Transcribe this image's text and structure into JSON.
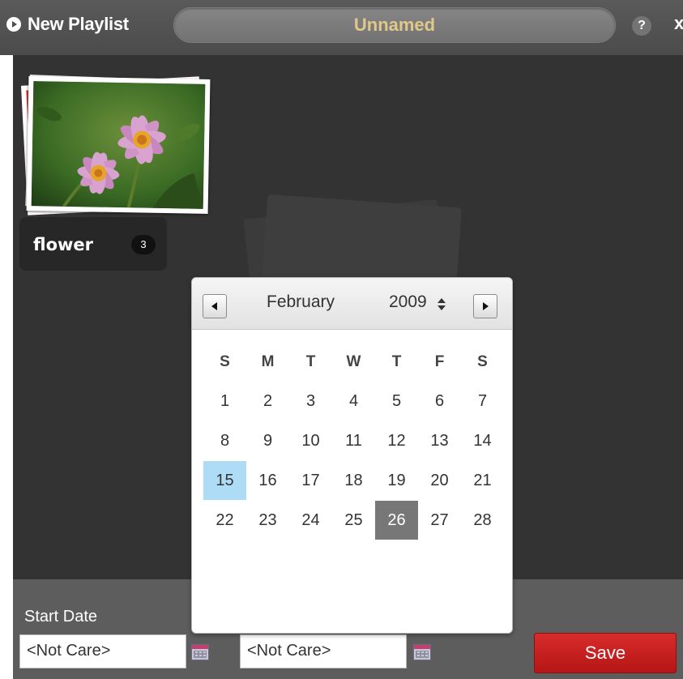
{
  "header": {
    "title": "New Playlist",
    "playlist_name": "Unnamed",
    "help_label": "?",
    "close_label": "x"
  },
  "album": {
    "name": "flower",
    "count": "3"
  },
  "calendar": {
    "month": "February",
    "year": "2009",
    "days_of_week": [
      "S",
      "M",
      "T",
      "W",
      "T",
      "F",
      "S"
    ],
    "weeks": [
      [
        "1",
        "2",
        "3",
        "4",
        "5",
        "6",
        "7"
      ],
      [
        "8",
        "9",
        "10",
        "11",
        "12",
        "13",
        "14"
      ],
      [
        "15",
        "16",
        "17",
        "18",
        "19",
        "20",
        "21"
      ],
      [
        "22",
        "23",
        "24",
        "25",
        "26",
        "27",
        "28"
      ]
    ],
    "highlighted_day": "15",
    "selected_day": "26"
  },
  "bottom_bar": {
    "start_date_label": "Start Date",
    "start_date_value": "<Not Care>",
    "end_date_value": "<Not Care>",
    "save_label": "Save"
  },
  "colors": {
    "save_button": "#c81e1e",
    "highlight_day": "#aedbf5",
    "selected_day": "#777777",
    "playlist_name_text": "#e0c88a"
  }
}
